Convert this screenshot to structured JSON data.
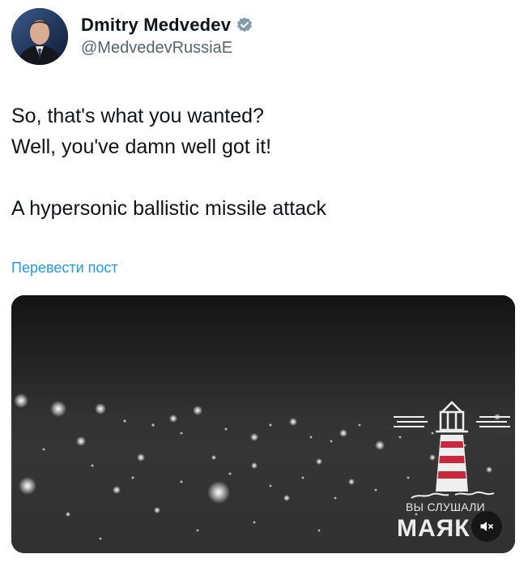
{
  "author": {
    "display_name": "Dmitry Medvedev",
    "handle": "@MedvedevRussiaE",
    "verified_color": "#829aab"
  },
  "tweet": {
    "lines": [
      "So, that's what you wanted?",
      "Well, you've damn well got it!",
      "",
      "A hypersonic ballistic missile attack"
    ],
    "translate_label": "Перевести пост"
  },
  "media": {
    "watermark_caption": "ВЫ СЛУШАЛИ",
    "watermark_brand": "МАЯК",
    "mute_icon": "speaker-muted-icon"
  },
  "colors": {
    "link": "#1d9bf0",
    "secondary_text": "#536471",
    "lighthouse_red": "#c8283c"
  }
}
